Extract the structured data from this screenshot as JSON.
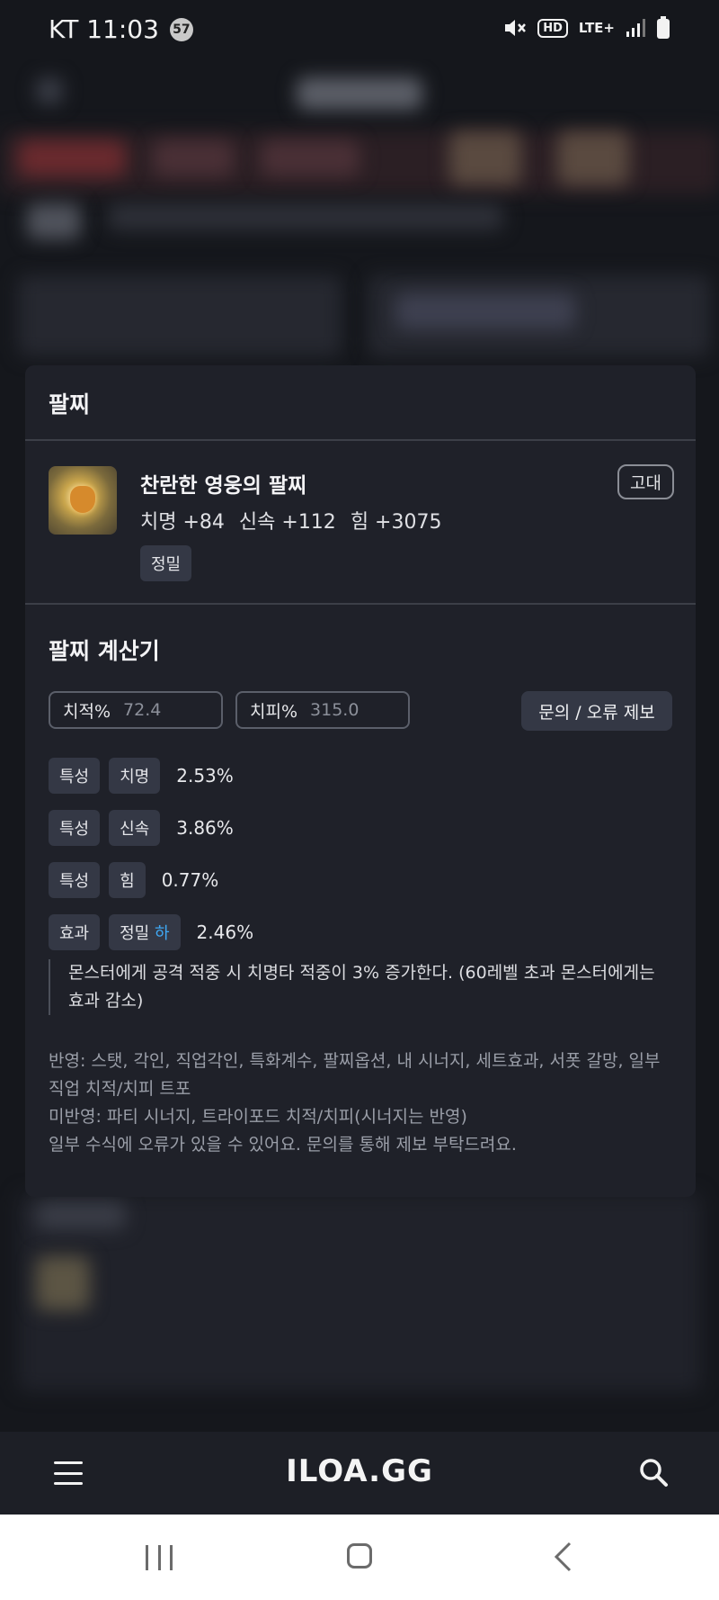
{
  "status_bar": {
    "carrier_time": "KT 11:03",
    "notification_count": "57",
    "hd": "HD",
    "network": "LTE+"
  },
  "card": {
    "title": "팔찌",
    "item": {
      "name": "찬란한 영웅의 팔찌",
      "grade": "고대",
      "stats": [
        "치명 +84",
        "신속 +112",
        "힘 +3075"
      ],
      "tag": "정밀"
    },
    "calculator": {
      "title": "팔찌 계산기",
      "crit_rate_label": "치적%",
      "crit_rate_value": "72.4",
      "crit_dmg_label": "치피%",
      "crit_dmg_value": "315.0",
      "report_button": "문의 / 오류 제보",
      "rows": [
        {
          "kind": "특성",
          "name": "치명",
          "percent": "2.53%"
        },
        {
          "kind": "특성",
          "name": "신속",
          "percent": "3.86%"
        },
        {
          "kind": "특성",
          "name": "힘",
          "percent": "0.77%"
        },
        {
          "kind": "효과",
          "name": "정밀",
          "level": "하",
          "percent": "2.46%"
        }
      ],
      "effect_description": "몬스터에게 공격 적중 시 치명타 적중이 3% 증가한다. (60레벨 초과 몬스터에게는 효과 감소)",
      "notes": [
        "반영: 스탯, 각인, 직업각인, 특화계수, 팔찌옵션, 내 시너지, 세트효과, 서폿 갈망, 일부 직업 치적/치피 트포",
        "미반영: 파티 시너지, 트라이포드 치적/치피(시너지는 반영)",
        "일부 수식에 오류가 있을 수 있어요. 문의를 통해 제보 부탁드려요."
      ]
    }
  },
  "app_bar": {
    "logo": "ILOA.GG",
    "menu_icon": "hamburger-menu-icon",
    "search_icon": "search-icon"
  },
  "colors": {
    "accent_blue": "#3fa9f5",
    "card_bg": "#1f2129",
    "tag_bg": "#343845"
  }
}
